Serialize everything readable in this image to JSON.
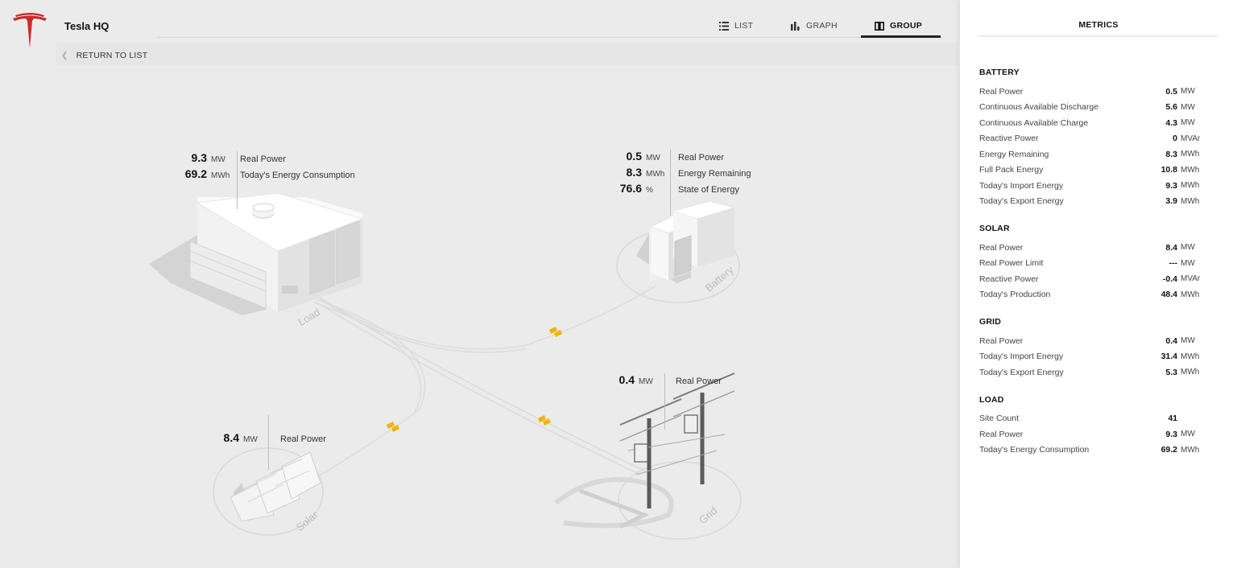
{
  "app": {
    "site_title": "Tesla HQ",
    "return_label": "RETURN TO LIST",
    "brand_color": "#cc2a2a"
  },
  "tabs": [
    {
      "label": "LIST",
      "icon": "list-icon",
      "active": false
    },
    {
      "label": "GRAPH",
      "icon": "bar-chart-icon",
      "active": false
    },
    {
      "label": "GROUP",
      "icon": "group-icon",
      "active": true
    }
  ],
  "nodes": {
    "load": {
      "name": "Load",
      "readouts": [
        {
          "value": "9.3",
          "unit": "MW",
          "label": "Real Power"
        },
        {
          "value": "69.2",
          "unit": "MWh",
          "label": "Today's Energy Consumption"
        }
      ]
    },
    "battery": {
      "name": "Battery",
      "readouts": [
        {
          "value": "0.5",
          "unit": "MW",
          "label": "Real Power"
        },
        {
          "value": "8.3",
          "unit": "MWh",
          "label": "Energy Remaining"
        },
        {
          "value": "76.6",
          "unit": "%",
          "label": "State of Energy"
        }
      ]
    },
    "solar": {
      "name": "Solar",
      "readouts": [
        {
          "value": "8.4",
          "unit": "MW",
          "label": "Real Power"
        }
      ]
    },
    "grid": {
      "name": "Grid",
      "readouts": [
        {
          "value": "0.4",
          "unit": "MW",
          "label": "Real Power"
        }
      ]
    }
  },
  "flow_color": "#f0b400",
  "metrics": {
    "title": "METRICS",
    "sections": [
      {
        "title": "BATTERY",
        "rows": [
          {
            "label": "Real Power",
            "value": "0.5",
            "unit": "MW"
          },
          {
            "label": "Continuous Available Discharge",
            "value": "5.6",
            "unit": "MW"
          },
          {
            "label": "Continuous Available Charge",
            "value": "4.3",
            "unit": "MW"
          },
          {
            "label": "Reactive Power",
            "value": "0",
            "unit": "MVAr"
          },
          {
            "label": "Energy Remaining",
            "value": "8.3",
            "unit": "MWh"
          },
          {
            "label": "Full Pack Energy",
            "value": "10.8",
            "unit": "MWh"
          },
          {
            "label": "Today's Import Energy",
            "value": "9.3",
            "unit": "MWh"
          },
          {
            "label": "Today's Export Energy",
            "value": "3.9",
            "unit": "MWh"
          }
        ]
      },
      {
        "title": "SOLAR",
        "rows": [
          {
            "label": "Real Power",
            "value": "8.4",
            "unit": "MW"
          },
          {
            "label": "Real Power Limit",
            "value": "---",
            "unit": "MW"
          },
          {
            "label": "Reactive Power",
            "value": "-0.4",
            "unit": "MVAr"
          },
          {
            "label": "Today's Production",
            "value": "48.4",
            "unit": "MWh"
          }
        ]
      },
      {
        "title": "GRID",
        "rows": [
          {
            "label": "Real Power",
            "value": "0.4",
            "unit": "MW"
          },
          {
            "label": "Today's Import Energy",
            "value": "31.4",
            "unit": "MWh"
          },
          {
            "label": "Today's Export Energy",
            "value": "5.3",
            "unit": "MWh"
          }
        ]
      },
      {
        "title": "LOAD",
        "rows": [
          {
            "label": "Site Count",
            "value": "41",
            "unit": ""
          },
          {
            "label": "Real Power",
            "value": "9.3",
            "unit": "MW"
          },
          {
            "label": "Today's Energy Consumption",
            "value": "69.2",
            "unit": "MWh"
          }
        ]
      }
    ]
  }
}
